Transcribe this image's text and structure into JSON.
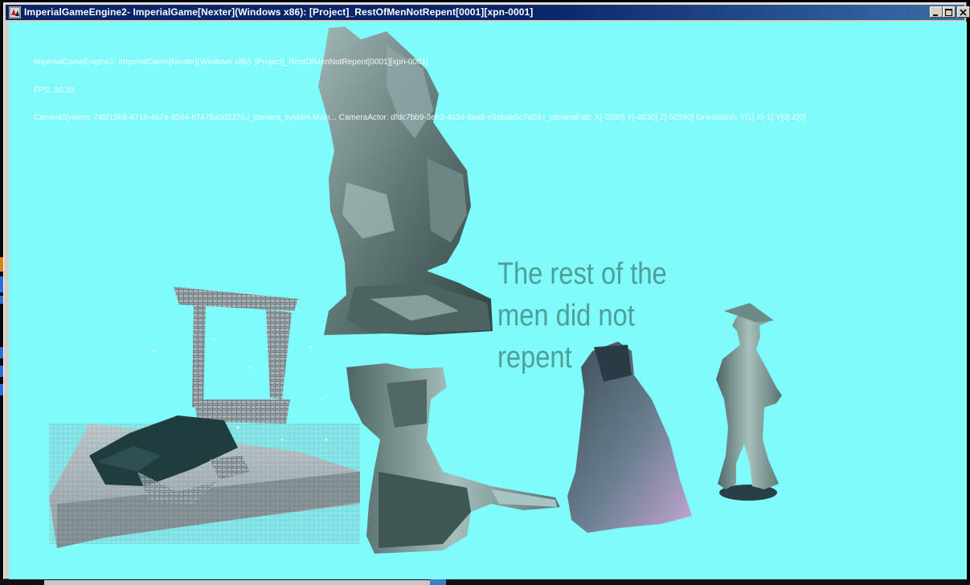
{
  "window": {
    "title": "ImperialGameEngine2- ImperialGame[Nexter](Windows x86): [Project]_RestOfMenNotRepent[0001][xpn-0001]",
    "controls": {
      "minimize": "minimize",
      "maximize": "maximize",
      "close": "close"
    }
  },
  "hud": {
    "title_line": "ImperialGameEngine2- ImperialGame[Nexter](Windows x86): [Project]_RestOfMenNotRepent[0001][xpn-0001]",
    "fps_line": "FPS: 30.30",
    "camera_line": "CameraSystem: 745f15b9-6716-4a7a-8564-b7478add237a.i_camera_system.Main... CameraActor: dfdc7bb9-3eb2-4c3d-8aa8-e9abab5c7d2d.i_cameraFab: X[-3290] Y[-4830] Z[-50590] Orientation: Y[1] X[-1] Y[0] Z[0]"
  },
  "scene": {
    "background": "#7ffbfb",
    "caption_lines": [
      "The rest of the",
      "men did not",
      "repent"
    ],
    "caption_color": "#4f9e98",
    "objects": [
      "angel-warrior-statue",
      "ruined-shrine-model",
      "seated-figure-statue",
      "rock-monolith",
      "standing-man-statue"
    ]
  }
}
